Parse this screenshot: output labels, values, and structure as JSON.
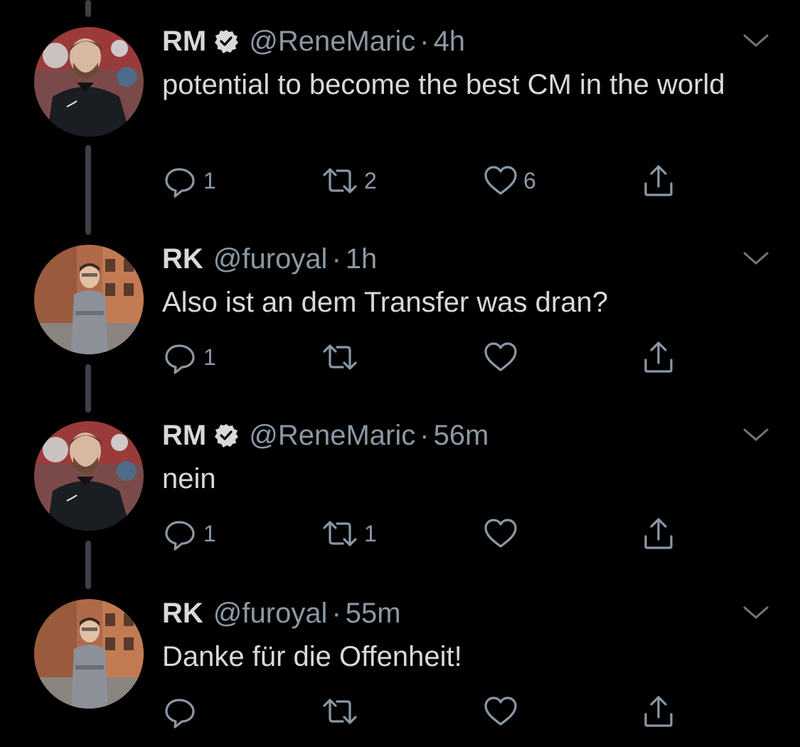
{
  "colors": {
    "background": "#000000",
    "text_primary": "#d9d9d9",
    "text_secondary": "#8b98a5",
    "thread_line": "#3d4147"
  },
  "tweets": [
    {
      "name": "RM",
      "verified": true,
      "handle": "@ReneMaric",
      "separator": "·",
      "time": "4h",
      "text": "potential to become the best CM in the world",
      "reply_count": "1",
      "retweet_count": "2",
      "like_count": "6"
    },
    {
      "name": "RK",
      "verified": false,
      "handle": "@furoyal",
      "separator": "·",
      "time": "1h",
      "text": "Also ist an dem Transfer was dran?",
      "reply_count": "1",
      "retweet_count": "",
      "like_count": ""
    },
    {
      "name": "RM",
      "verified": true,
      "handle": "@ReneMaric",
      "separator": "·",
      "time": "56m",
      "text": "nein",
      "reply_count": "1",
      "retweet_count": "1",
      "like_count": ""
    },
    {
      "name": "RK",
      "verified": false,
      "handle": "@furoyal",
      "separator": "·",
      "time": "55m",
      "text": "Danke für die Offenheit!",
      "reply_count": "",
      "retweet_count": "",
      "like_count": ""
    }
  ],
  "icons": {
    "reply": "reply-icon",
    "retweet": "retweet-icon",
    "like": "heart-icon",
    "share": "share-icon",
    "verified": "verified-badge-icon",
    "more": "chevron-down-icon"
  }
}
